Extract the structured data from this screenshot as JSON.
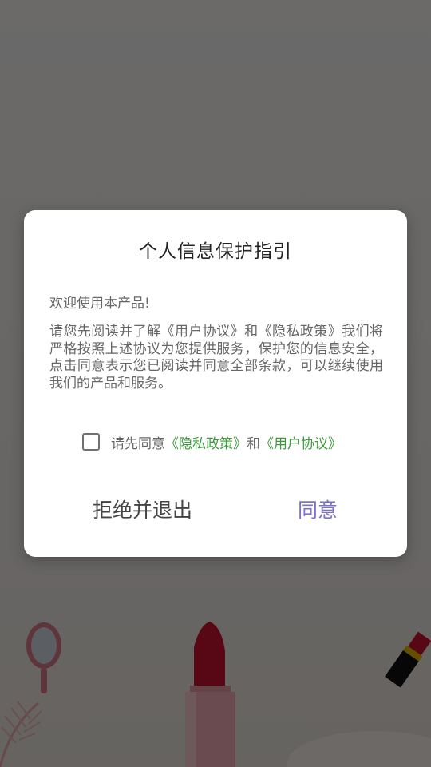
{
  "dialog": {
    "title": "个人信息保护指引",
    "greeting": "欢迎使用本产品!",
    "body": "请您先阅读并了解《用户协议》和《隐私政策》我们将严格按照上述协议为您提供服务，保护您的信息安全，点击同意表示您已阅读并同意全部条款，可以继续使用我们的产品和服务。",
    "consent": {
      "checked": false,
      "prefix": "请先同意",
      "privacy_link": "《隐私政策》",
      "joiner": "和",
      "terms_link": "《用户协议》"
    },
    "reject_label": "拒绝并退出",
    "agree_label": "同意"
  },
  "colors": {
    "overlay": "#000000",
    "link": "#3d9a3d",
    "agree": "#7b6fd0",
    "lipstick": "#c8102e"
  },
  "icons": {
    "checkbox": "checkbox-unchecked-icon",
    "mirror": "hand-mirror-icon",
    "lipstick": "lipstick-icon",
    "small_lipstick": "small-lipstick-icon",
    "feather": "feather-icon"
  }
}
